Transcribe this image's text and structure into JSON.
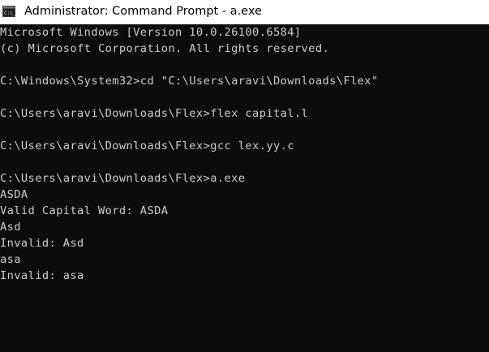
{
  "window": {
    "title": "Administrator: Command Prompt - a.exe",
    "icon": "cmd-icon"
  },
  "console": {
    "lines": [
      "Microsoft Windows [Version 10.0.26100.6584]",
      "(c) Microsoft Corporation. All rights reserved.",
      "",
      "C:\\Windows\\System32>cd \"C:\\Users\\aravi\\Downloads\\Flex\"",
      "",
      "C:\\Users\\aravi\\Downloads\\Flex>flex capital.l",
      "",
      "C:\\Users\\aravi\\Downloads\\Flex>gcc lex.yy.c",
      "",
      "C:\\Users\\aravi\\Downloads\\Flex>a.exe",
      "ASDA",
      "Valid Capital Word: ASDA",
      "Asd",
      "Invalid: Asd",
      "asa",
      "Invalid: asa"
    ]
  },
  "colors": {
    "console_background": "#0c0c0c",
    "console_text": "#cccccc",
    "titlebar_background": "#ffffff"
  }
}
